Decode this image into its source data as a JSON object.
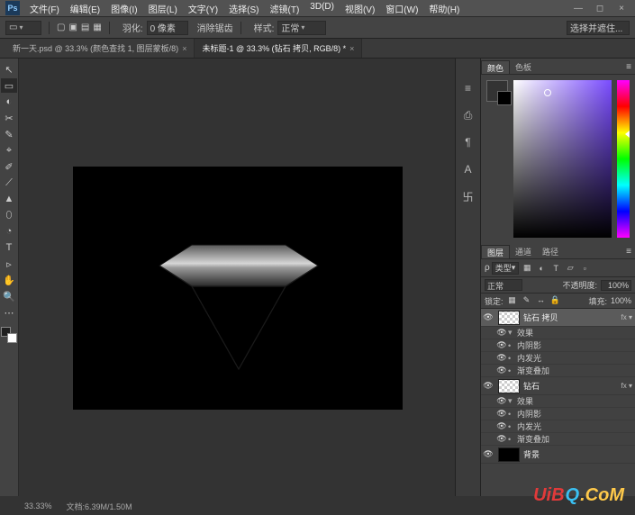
{
  "app": {
    "logo": "Ps"
  },
  "menu": [
    "文件(F)",
    "编辑(E)",
    "图像(I)",
    "图层(L)",
    "文字(Y)",
    "选择(S)",
    "滤镜(T)",
    "3D(D)",
    "视图(V)",
    "窗口(W)",
    "帮助(H)"
  ],
  "options": {
    "feather_lbl": "羽化:",
    "feather_val": "0 像素",
    "remove_lbl": "消除锯齿",
    "style_lbl": "样式:",
    "style_val": "正常",
    "select_lbl": "选择并遮住..."
  },
  "tabs": [
    {
      "label": "新一天.psd @ 33.3% (颜色查找 1, 图层蒙板/8)",
      "active": false
    },
    {
      "label": "未标题-1 @ 33.3% (钻石 拷贝, RGB/8) *",
      "active": true
    }
  ],
  "tools": [
    "↖",
    "▭",
    "◐",
    "✂",
    "✎",
    "⌖",
    "✐",
    "⟋",
    "▲",
    "⬯",
    "◔",
    "T",
    "▹",
    "✋",
    "🔍",
    "⋯"
  ],
  "rightstrip": [
    "≡",
    "⎙",
    "¶",
    "A",
    "卐"
  ],
  "panels": {
    "tabset1": [
      "颜色",
      "色板"
    ],
    "tabset2": [
      "图层",
      "通道",
      "路径"
    ],
    "type_lbl": "类型",
    "blend": "正常",
    "opacity_lbl": "不透明度:",
    "opacity": "100%",
    "lock_lbl": "锁定:",
    "fill_lbl": "填充:",
    "fill": "100%"
  },
  "layers": [
    {
      "name": "钻石 拷贝",
      "selected": true,
      "hasFx": true,
      "fx": [
        "效果",
        "内阴影",
        "内发光",
        "渐变叠加"
      ]
    },
    {
      "name": "钻石",
      "selected": false,
      "hasFx": true,
      "fx": [
        "效果",
        "内阴影",
        "内发光",
        "渐变叠加"
      ]
    },
    {
      "name": "背景",
      "selected": false,
      "hasFx": false,
      "solid": true
    }
  ],
  "status": {
    "zoom": "33.33%",
    "docsize": "文档:6.39M/1.50M"
  },
  "watermark": {
    "p1": "UiB",
    "p2": "Q",
    "p3": ".CoM"
  }
}
